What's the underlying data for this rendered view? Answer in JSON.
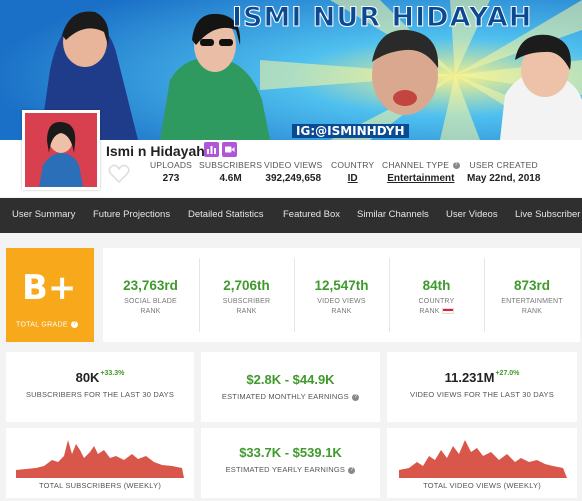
{
  "banner": {
    "title": "ISMI NUR HIDAYAH",
    "ig_handle": "IG:@ISMINHDYH"
  },
  "channel": {
    "name": "Ismi n Hidayah",
    "stats": [
      {
        "label": "UPLOADS",
        "value": "273"
      },
      {
        "label": "SUBSCRIBERS",
        "value": "4.6M"
      },
      {
        "label": "VIDEO VIEWS",
        "value": "392,249,658"
      },
      {
        "label": "COUNTRY",
        "value": "ID"
      },
      {
        "label": "CHANNEL TYPE",
        "value": "Entertainment"
      },
      {
        "label": "USER CREATED",
        "value": "May 22nd, 2018"
      }
    ]
  },
  "nav": [
    "User Summary",
    "Future Projections",
    "Detailed Statistics",
    "Featured Box",
    "Similar Channels",
    "User Videos",
    "Live Subscriber"
  ],
  "grade": {
    "value": "B+",
    "label": "TOTAL GRADE"
  },
  "ranks": [
    {
      "value": "23,763rd",
      "label1": "SOCIAL BLADE",
      "label2": "RANK"
    },
    {
      "value": "2,706th",
      "label1": "SUBSCRIBER",
      "label2": "RANK"
    },
    {
      "value": "12,547th",
      "label1": "VIDEO VIEWS",
      "label2": "RANK"
    },
    {
      "value": "84th",
      "label1": "COUNTRY",
      "label2": "RANK"
    },
    {
      "value": "873rd",
      "label1": "ENTERTAINMENT",
      "label2": "RANK"
    }
  ],
  "subs_30": {
    "value": "80K",
    "change": "+33.3%",
    "label": "SUBSCRIBERS FOR THE LAST 30 DAYS"
  },
  "monthly": {
    "value": "$2.8K - $44.9K",
    "label": "ESTIMATED MONTHLY EARNINGS"
  },
  "views_30": {
    "value": "11.231M",
    "change": "+27.0%",
    "label": "VIDEO VIEWS FOR THE LAST 30 DAYS"
  },
  "yearly": {
    "value": "$33.7K - $539.1K",
    "label": "ESTIMATED YEARLY EARNINGS"
  },
  "chart_subs_label": "TOTAL SUBSCRIBERS (WEEKLY)",
  "chart_views_label": "TOTAL VIDEO VIEWS (WEEKLY)",
  "colors": {
    "grade": "#f7a81b",
    "rank_value": "#3f9a2c",
    "nav_bg": "#2f2f2f",
    "chart_fill": "#d9574a"
  }
}
